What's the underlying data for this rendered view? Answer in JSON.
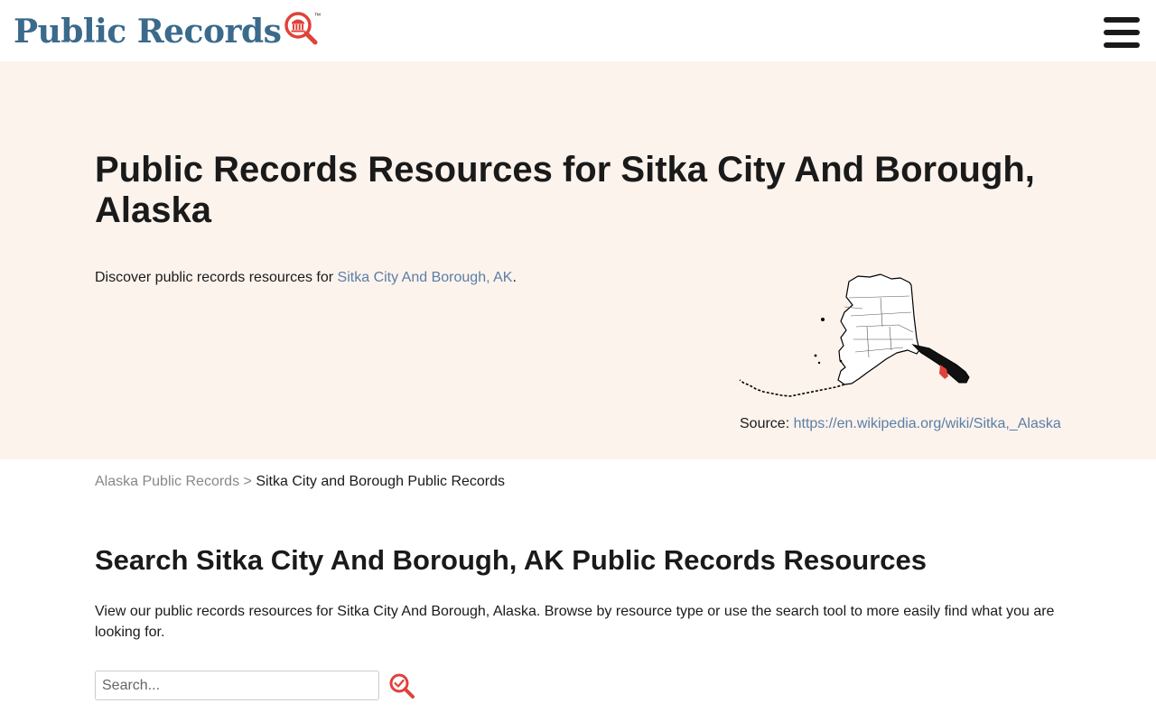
{
  "header": {
    "logo_text": "Public Records",
    "logo_tm": "™",
    "logo_icon": "courthouse-magnifier-icon",
    "menu_icon": "hamburger-menu-icon"
  },
  "hero": {
    "title": "Public Records Resources for Sitka City And Borough, Alaska",
    "intro_prefix": "Discover public records resources for ",
    "intro_link": "Sitka City And Borough, AK",
    "intro_suffix": ".",
    "map_icon": "alaska-map-sitka-highlight",
    "source_label": "Source: ",
    "source_link": "https://en.wikipedia.org/wiki/Sitka,_Alaska"
  },
  "breadcrumb": {
    "parent": "Alaska Public Records",
    "separator": ">",
    "current": "Sitka City and Borough Public Records"
  },
  "main": {
    "title": "Search Sitka City And Borough, AK Public Records Resources",
    "description": "View our public records resources for Sitka City And Borough, Alaska. Browse by resource type or use the search tool to more easily find what you are looking for.",
    "search_placeholder": "Search...",
    "search_icon": "search-check-icon"
  },
  "colors": {
    "brand_blue": "#3a6a8c",
    "link_blue": "#5b7ea5",
    "accent_red": "#e0413a",
    "hero_bg": "#fcf3ed"
  }
}
